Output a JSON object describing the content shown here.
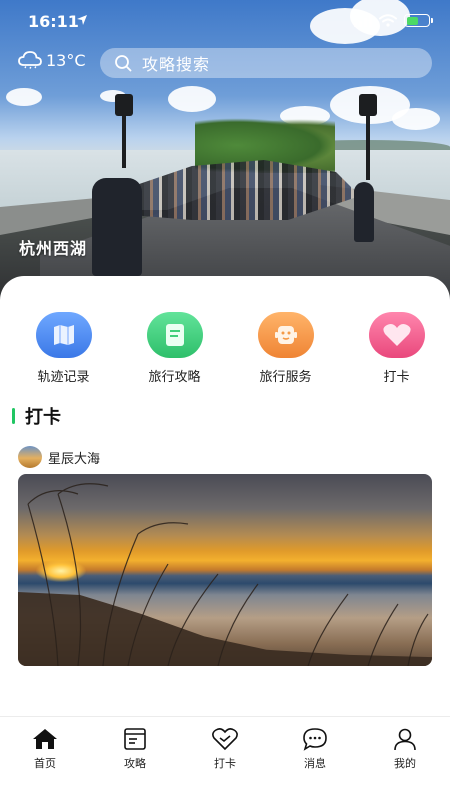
{
  "status_bar": {
    "time": "16:11",
    "battery_level": 0.55,
    "battery_color": "#4cd964"
  },
  "header": {
    "weather_icon": "cloud-icon",
    "temperature": "13°C",
    "search_icon": "search-icon",
    "search_placeholder": "攻略搜索"
  },
  "hero": {
    "caption": "杭州西湖"
  },
  "categories": [
    {
      "label": "轨迹记录",
      "icon": "map-icon",
      "color": "#4a86ee"
    },
    {
      "label": "旅行攻略",
      "icon": "guide-icon",
      "color": "#3fcf7a"
    },
    {
      "label": "旅行服务",
      "icon": "service-icon",
      "color": "#f59a47"
    },
    {
      "label": "打卡",
      "icon": "heart-icon",
      "color": "#f0628f"
    }
  ],
  "section": {
    "title": "打卡",
    "accent_color": "#21c663"
  },
  "post": {
    "author": "星辰大海"
  },
  "tabbar": {
    "tabs": [
      {
        "label": "首页",
        "icon": "home-icon",
        "active": true
      },
      {
        "label": "攻略",
        "icon": "guide-book-icon",
        "active": false
      },
      {
        "label": "打卡",
        "icon": "heart-icon",
        "active": false
      },
      {
        "label": "消息",
        "icon": "chat-icon",
        "active": false
      },
      {
        "label": "我的",
        "icon": "profile-icon",
        "active": false
      }
    ]
  }
}
